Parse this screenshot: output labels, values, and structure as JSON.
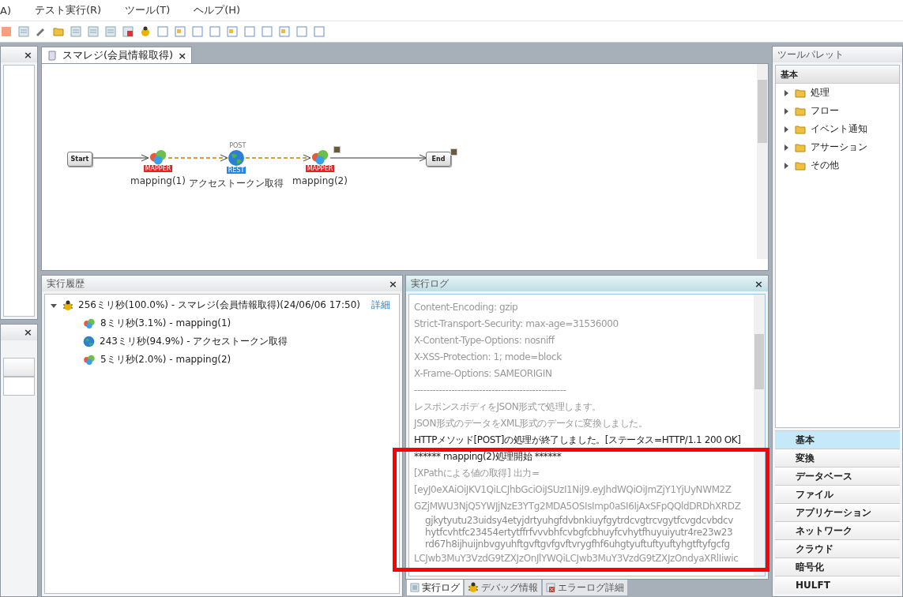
{
  "menu": [
    "A)",
    "テスト実行(R)",
    "ツール(T)",
    "ヘルプ(H)"
  ],
  "editor": {
    "tab": "スマレジ(会員情報取得)",
    "tab_close": "×",
    "nodes": [
      {
        "kind": "start",
        "label": "Start"
      },
      {
        "kind": "mapper",
        "badge": "MAPPER",
        "caption": "mapping(1)",
        "flag": false
      },
      {
        "kind": "rest",
        "badge": "REST",
        "method": "POST",
        "caption": "アクセストークン取得",
        "flag": false
      },
      {
        "kind": "mapper",
        "badge": "MAPPER",
        "caption": "mapping(2)",
        "flag": true
      },
      {
        "kind": "end",
        "label": "End",
        "flag": true
      }
    ]
  },
  "left_panels": [
    {
      "close": "×"
    },
    {
      "close": "×"
    }
  ],
  "history": {
    "title": "実行履歴",
    "close": "×",
    "items": [
      {
        "kind": "script",
        "text": "256ミリ秒(100.0%) - スマレジ(会員情報取得)(24/06/06 17:50)",
        "link": "詳細",
        "expanded": true,
        "children": [
          {
            "kind": "mapper",
            "text": "8ミリ秒(3.1%) - mapping(1)"
          },
          {
            "kind": "rest",
            "text": "243ミリ秒(94.9%) - アクセストークン取得"
          },
          {
            "kind": "mapper",
            "text": "5ミリ秒(2.0%) - mapping(2)"
          }
        ]
      }
    ]
  },
  "log": {
    "title": "実行ログ",
    "close": "×",
    "lines": [
      {
        "kind": "muted",
        "text": "Content-Encoding: gzip"
      },
      {
        "kind": "muted",
        "text": "Strict-Transport-Security: max-age=31536000"
      },
      {
        "kind": "muted",
        "text": "X-Content-Type-Options: nosniff"
      },
      {
        "kind": "muted",
        "text": "X-XSS-Protection: 1; mode=block"
      },
      {
        "kind": "muted",
        "text": "X-Frame-Options: SAMEORIGIN"
      },
      {
        "kind": "muted",
        "text": "-------------------------------------------------"
      },
      {
        "kind": "muted",
        "text": "レスポンスボディをJSON形式で処理します。"
      },
      {
        "kind": "muted",
        "text": "JSON形式のデータをXML形式のデータに変換しました。"
      },
      {
        "kind": "normal",
        "text": "HTTPメソッド[POST]の処理が終了しました。[ステータス=HTTP/1.1 200 OK]"
      },
      {
        "kind": "normal",
        "text": "****** mapping(2)処理開始 ******"
      },
      {
        "kind": "muted",
        "text": "[XPathによる値の取得] 出力="
      },
      {
        "kind": "muted",
        "text": "[eyJ0eXAiOiJKV1QiLCJhbGciOiJSUzI1NiJ9.eyJhdWQiOiJmZjY1YjUyNWM2Z"
      },
      {
        "kind": "muted",
        "text": "GZjMWU3NjQ5YWJjNzE3YTg2MDA5OSIsImp0aSI6IjAxSFpQQldDRDhXRDZ"
      },
      {
        "kind": "pasted",
        "text": "gjkytyutu23uidsy4etyjdrtyuhgfdvbnkiuyfgytrdcvgtrcvgytfcvgdcvbdcv"
      },
      {
        "kind": "pasted",
        "text": "hytfcvhtfc23454ertytffrfvvvbhfcvbgfcbhuyfcvhytfhuyuiyutr4re23w23"
      },
      {
        "kind": "pasted",
        "text": "rd67h8ijhuijnbvgyuhftgvftgvfgvftvrygfhf6uhgtyuftuftyuftyhgtftyfgcfg"
      },
      {
        "kind": "muted",
        "text": "LCJwb3MuY3VzdG9tZXJzOnJlYWQiLCJwb3MuY3VzdG9tZXJzOndyaXRlIiwic"
      }
    ],
    "tabs": [
      {
        "kind": "log",
        "label": "実行ログ",
        "selected": true
      },
      {
        "kind": "debug",
        "label": "デバッグ情報",
        "selected": false
      },
      {
        "kind": "error",
        "label": "エラーログ詳細",
        "selected": false
      }
    ]
  },
  "palette": {
    "title": "ツールパレット",
    "section": "基本",
    "folders": [
      {
        "label": "処理",
        "expanded": false
      },
      {
        "label": "フロー",
        "expanded": false
      },
      {
        "label": "イベント通知",
        "expanded": false
      },
      {
        "label": "アサーション",
        "expanded": false
      },
      {
        "label": "その他",
        "expanded": false
      }
    ],
    "categories": [
      {
        "label": "基本",
        "selected": true
      },
      {
        "label": "変換",
        "selected": false
      },
      {
        "label": "データベース",
        "selected": false
      },
      {
        "label": "ファイル",
        "selected": false
      },
      {
        "label": "アプリケーション",
        "selected": false
      },
      {
        "label": "ネットワーク",
        "selected": false
      },
      {
        "label": "クラウド",
        "selected": false
      },
      {
        "label": "暗号化",
        "selected": false
      },
      {
        "label": "HULFT",
        "selected": false
      }
    ]
  }
}
